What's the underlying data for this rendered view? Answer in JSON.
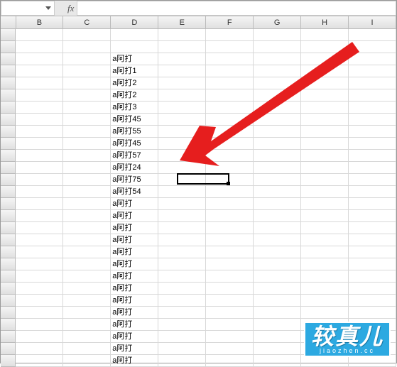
{
  "namebox": {
    "value": ""
  },
  "fx_label": "fx",
  "formula_value": "",
  "columns": [
    "B",
    "C",
    "D",
    "E",
    "F",
    "G",
    "H",
    "I"
  ],
  "data_column_index": 2,
  "cell_values": [
    "",
    "",
    "a阿打",
    "a阿打1",
    "a阿打2",
    "a阿打2",
    "a阿打3",
    "a阿打45",
    "a阿打55",
    "a阿打45",
    "a阿打57",
    "a阿打24",
    "a阿打75",
    "a阿打54",
    "a阿打",
    "a阿打",
    "a阿打",
    "a阿打",
    "a阿打",
    "a阿打",
    "a阿打",
    "a阿打",
    "a阿打",
    "a阿打",
    "a阿打",
    "a阿打",
    "a阿打",
    "a阿打"
  ],
  "selected": {
    "col": 3,
    "row": 12
  },
  "watermark": {
    "big": "较真儿",
    "small": "jiaozhen.cc"
  }
}
